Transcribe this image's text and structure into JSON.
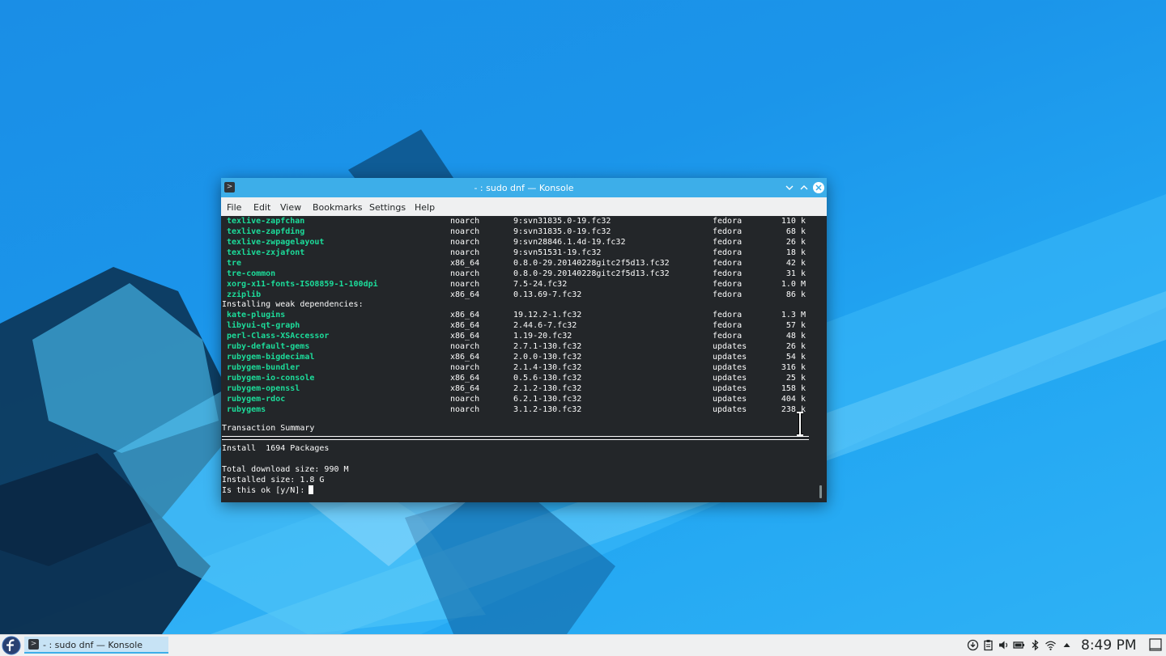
{
  "window": {
    "title": "- : sudo dnf — Konsole",
    "menu": [
      "File",
      "Edit",
      "View",
      "Bookmarks",
      "Settings",
      "Help"
    ]
  },
  "terminal": {
    "packages_top": [
      {
        "name": "texlive-zapfchan",
        "arch": "noarch",
        "version": "9:svn31835.0-19.fc32",
        "repo": "fedora",
        "size": "110 k"
      },
      {
        "name": "texlive-zapfding",
        "arch": "noarch",
        "version": "9:svn31835.0-19.fc32",
        "repo": "fedora",
        "size": "68 k"
      },
      {
        "name": "texlive-zwpagelayout",
        "arch": "noarch",
        "version": "9:svn28846.1.4d-19.fc32",
        "repo": "fedora",
        "size": "26 k"
      },
      {
        "name": "texlive-zxjafont",
        "arch": "noarch",
        "version": "9:svn51531-19.fc32",
        "repo": "fedora",
        "size": "18 k"
      },
      {
        "name": "tre",
        "arch": "x86_64",
        "version": "0.8.0-29.20140228gitc2f5d13.fc32",
        "repo": "fedora",
        "size": "42 k"
      },
      {
        "name": "tre-common",
        "arch": "noarch",
        "version": "0.8.0-29.20140228gitc2f5d13.fc32",
        "repo": "fedora",
        "size": "31 k"
      },
      {
        "name": "xorg-x11-fonts-ISO8859-1-100dpi",
        "arch": "noarch",
        "version": "7.5-24.fc32",
        "repo": "fedora",
        "size": "1.0 M"
      },
      {
        "name": "zziplib",
        "arch": "x86_64",
        "version": "0.13.69-7.fc32",
        "repo": "fedora",
        "size": "86 k"
      }
    ],
    "weak_header": "Installing weak dependencies:",
    "packages_weak": [
      {
        "name": "kate-plugins",
        "arch": "x86_64",
        "version": "19.12.2-1.fc32",
        "repo": "fedora",
        "size": "1.3 M"
      },
      {
        "name": "libyui-qt-graph",
        "arch": "x86_64",
        "version": "2.44.6-7.fc32",
        "repo": "fedora",
        "size": "57 k"
      },
      {
        "name": "perl-Class-XSAccessor",
        "arch": "x86_64",
        "version": "1.19-20.fc32",
        "repo": "fedora",
        "size": "48 k"
      },
      {
        "name": "ruby-default-gems",
        "arch": "noarch",
        "version": "2.7.1-130.fc32",
        "repo": "updates",
        "size": "26 k"
      },
      {
        "name": "rubygem-bigdecimal",
        "arch": "x86_64",
        "version": "2.0.0-130.fc32",
        "repo": "updates",
        "size": "54 k"
      },
      {
        "name": "rubygem-bundler",
        "arch": "noarch",
        "version": "2.1.4-130.fc32",
        "repo": "updates",
        "size": "316 k"
      },
      {
        "name": "rubygem-io-console",
        "arch": "x86_64",
        "version": "0.5.6-130.fc32",
        "repo": "updates",
        "size": "25 k"
      },
      {
        "name": "rubygem-openssl",
        "arch": "x86_64",
        "version": "2.1.2-130.fc32",
        "repo": "updates",
        "size": "158 k"
      },
      {
        "name": "rubygem-rdoc",
        "arch": "noarch",
        "version": "6.2.1-130.fc32",
        "repo": "updates",
        "size": "404 k"
      },
      {
        "name": "rubygems",
        "arch": "noarch",
        "version": "3.1.2-130.fc32",
        "repo": "updates",
        "size": "238 k"
      }
    ],
    "summary_header": "Transaction Summary",
    "install_line": "Install  1694 Packages",
    "download_size": "Total download size: 990 M",
    "installed_size": "Installed size: 1.8 G",
    "prompt": "Is this ok [y/N]: "
  },
  "taskbar": {
    "task_label": "- : sudo dnf — Konsole",
    "clock": "8:49 PM"
  },
  "colors": {
    "accent": "#3daee9",
    "package_green": "#1cdc9a",
    "terminal_bg": "#232629"
  }
}
